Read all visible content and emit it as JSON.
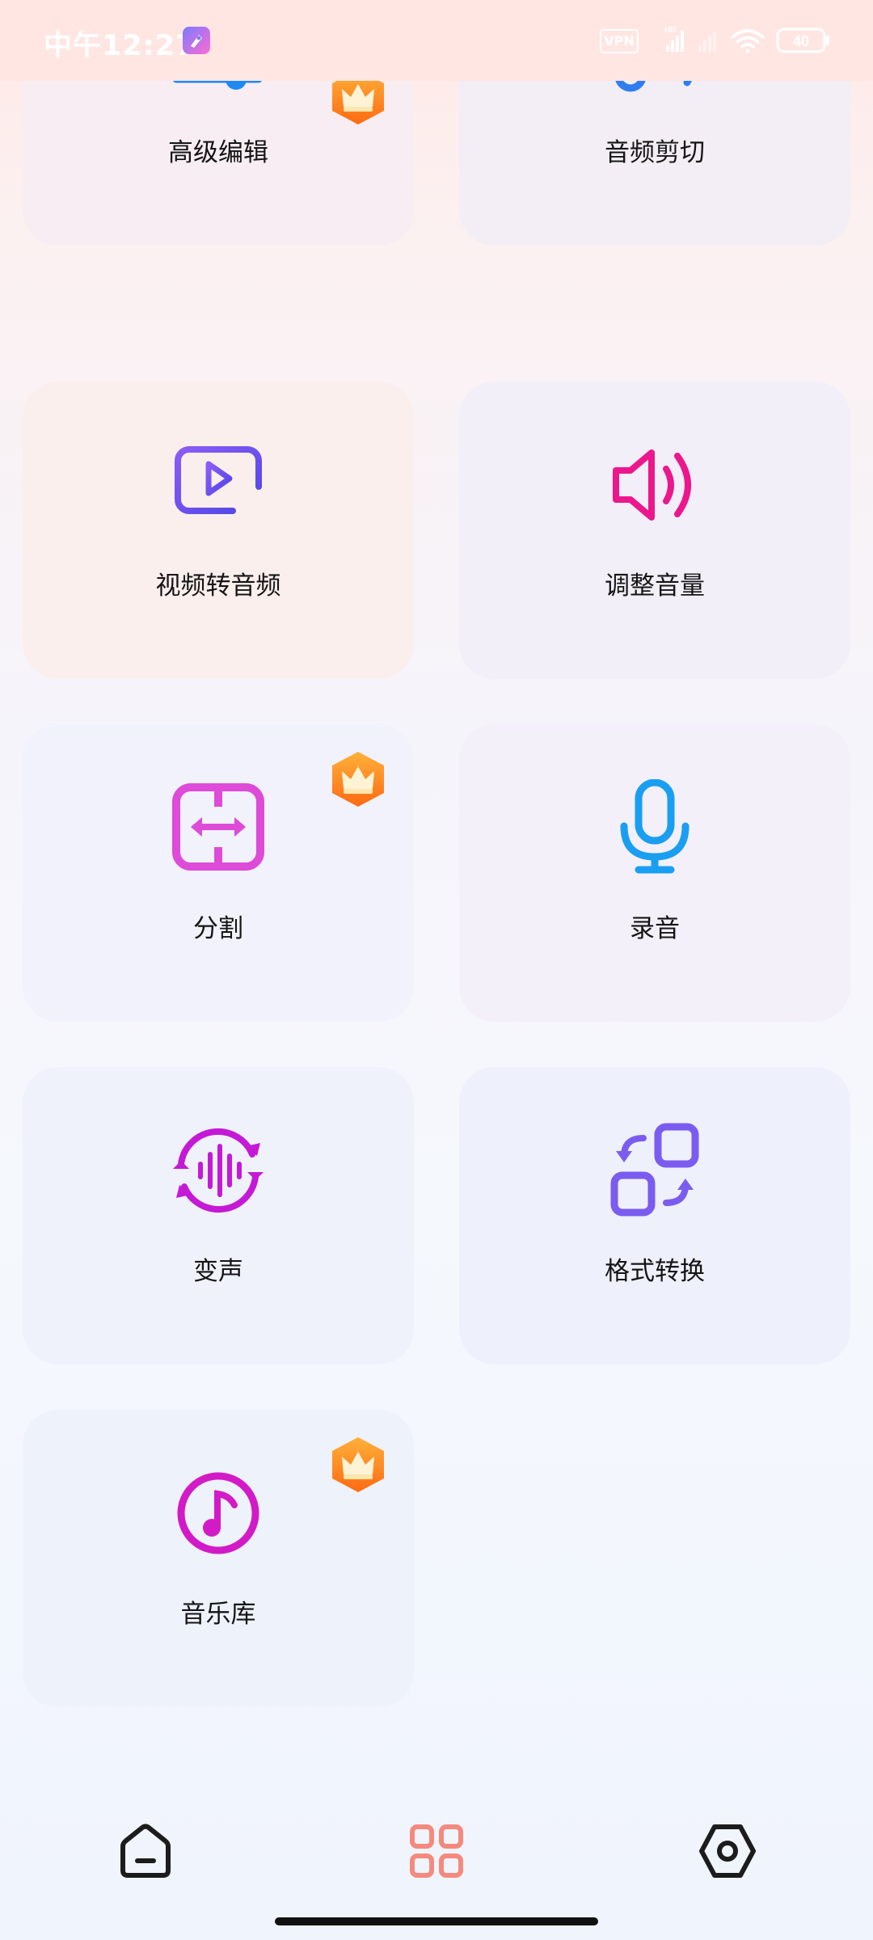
{
  "status_bar": {
    "time": "中午12:27",
    "vpn": "VPN",
    "battery": "40",
    "icons": [
      "app-rocket-icon",
      "vpn-icon",
      "hd-signal-icon",
      "signal-icon",
      "wifi-icon",
      "battery-icon"
    ]
  },
  "tools": [
    {
      "label": "高级编辑",
      "icon": "sliders-icon",
      "premium": true
    },
    {
      "label": "音频剪切",
      "icon": "scissors-icon",
      "premium": false
    },
    {
      "label": "视频转音频",
      "icon": "video-to-audio-icon",
      "premium": false
    },
    {
      "label": "调整音量",
      "icon": "volume-icon",
      "premium": false
    },
    {
      "label": "分割",
      "icon": "split-icon",
      "premium": true
    },
    {
      "label": "录音",
      "icon": "microphone-icon",
      "premium": false
    },
    {
      "label": "变声",
      "icon": "voice-change-icon",
      "premium": false
    },
    {
      "label": "格式转换",
      "icon": "format-convert-icon",
      "premium": false
    },
    {
      "label": "音乐库",
      "icon": "music-library-icon",
      "premium": true
    }
  ],
  "bottom_nav": {
    "items": [
      {
        "icon": "home-icon",
        "active": false
      },
      {
        "icon": "grid-icon",
        "active": true
      },
      {
        "icon": "settings-icon",
        "active": false
      }
    ]
  },
  "colors": {
    "accent": "#f48a7d",
    "crown_orange": "#ff8a1c"
  }
}
